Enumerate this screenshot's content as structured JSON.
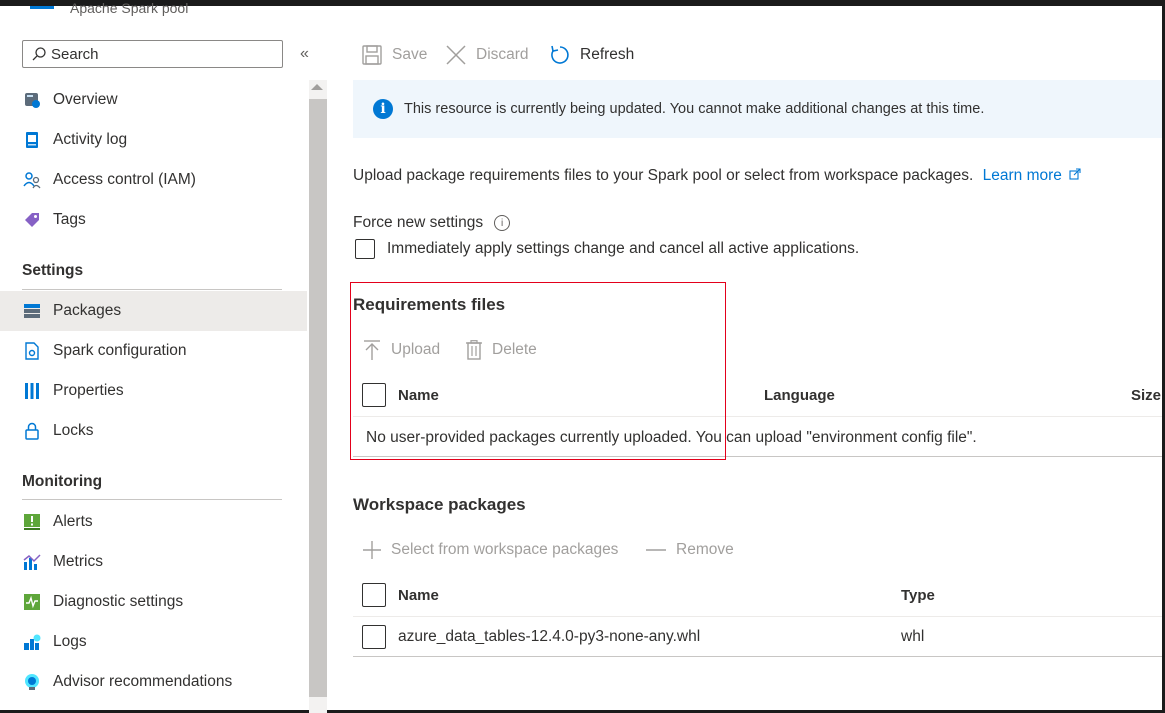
{
  "resource": {
    "subtitle": "Apache Spark pool"
  },
  "sidebar": {
    "search_placeholder": "Search",
    "collapse_glyph": "«",
    "items": [
      {
        "label": "Overview",
        "icon": "overview-icon"
      },
      {
        "label": "Activity log",
        "icon": "activity-log-icon"
      },
      {
        "label": "Access control (IAM)",
        "icon": "access-control-icon"
      },
      {
        "label": "Tags",
        "icon": "tag-icon"
      }
    ],
    "settings_title": "Settings",
    "settings_items": [
      {
        "label": "Packages",
        "icon": "packages-icon",
        "selected": true
      },
      {
        "label": "Spark configuration",
        "icon": "spark-config-icon"
      },
      {
        "label": "Properties",
        "icon": "properties-icon"
      },
      {
        "label": "Locks",
        "icon": "lock-icon"
      }
    ],
    "monitoring_title": "Monitoring",
    "monitoring_items": [
      {
        "label": "Alerts",
        "icon": "alerts-icon"
      },
      {
        "label": "Metrics",
        "icon": "metrics-icon"
      },
      {
        "label": "Diagnostic settings",
        "icon": "diagnostic-icon"
      },
      {
        "label": "Logs",
        "icon": "logs-icon"
      },
      {
        "label": "Advisor recommendations",
        "icon": "advisor-icon"
      }
    ]
  },
  "toolbar": {
    "save_label": "Save",
    "discard_label": "Discard",
    "refresh_label": "Refresh"
  },
  "banner": {
    "message": "This resource is currently being updated. You cannot make additional changes at this time."
  },
  "description": {
    "text": "Upload package requirements files to your Spark pool or select from workspace packages.",
    "link": "Learn more"
  },
  "force_settings": {
    "label": "Force new settings",
    "checkbox_label": "Immediately apply settings change and cancel all active applications."
  },
  "requirements": {
    "title": "Requirements files",
    "upload_label": "Upload",
    "delete_label": "Delete",
    "columns": [
      "Name",
      "Language",
      "Size"
    ],
    "empty_message": "No user-provided packages currently uploaded. You can upload \"environment config file\"."
  },
  "workspace": {
    "title": "Workspace packages",
    "select_label": "Select from workspace packages",
    "remove_label": "Remove",
    "columns": [
      "Name",
      "Type"
    ],
    "rows": [
      {
        "name": "azure_data_tables-12.4.0-py3-none-any.whl",
        "type": "whl"
      }
    ]
  },
  "colors": {
    "accent": "#0078d4",
    "highlight_box": "#e3001b",
    "banner_bg": "#eff6fc",
    "selected_bg": "#edebe9"
  }
}
